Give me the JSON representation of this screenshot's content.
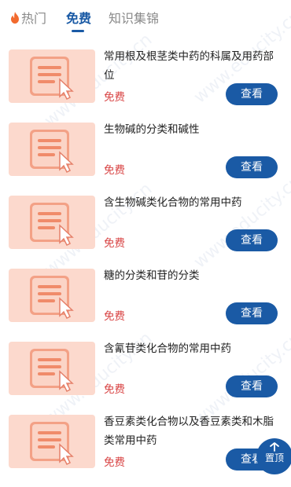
{
  "tabs": [
    {
      "label": "热门",
      "active": false
    },
    {
      "label": "免费",
      "active": true
    },
    {
      "label": "知识集锦",
      "active": false
    }
  ],
  "items": [
    {
      "title": "常用根及根茎类中药的科属及用药部位",
      "price": "免费",
      "button": "查看"
    },
    {
      "title": "生物碱的分类和碱性",
      "price": "免费",
      "button": "查看"
    },
    {
      "title": "含生物碱类化合物的常用中药",
      "price": "免费",
      "button": "查看"
    },
    {
      "title": "糖的分类和苷的分类",
      "price": "免费",
      "button": "查看"
    },
    {
      "title": "含氰苷类化合物的常用中药",
      "price": "免费",
      "button": "查看"
    },
    {
      "title": "香豆素类化合物以及香豆素类和木脂类常用中药",
      "price": "免费",
      "button": "查看"
    }
  ],
  "back_to_top": "置顶",
  "colors": {
    "accent": "#1a5aa5",
    "price": "#d84343",
    "thumb_bg": "#fcd9cd",
    "hot_icon": "#f26a2e"
  }
}
